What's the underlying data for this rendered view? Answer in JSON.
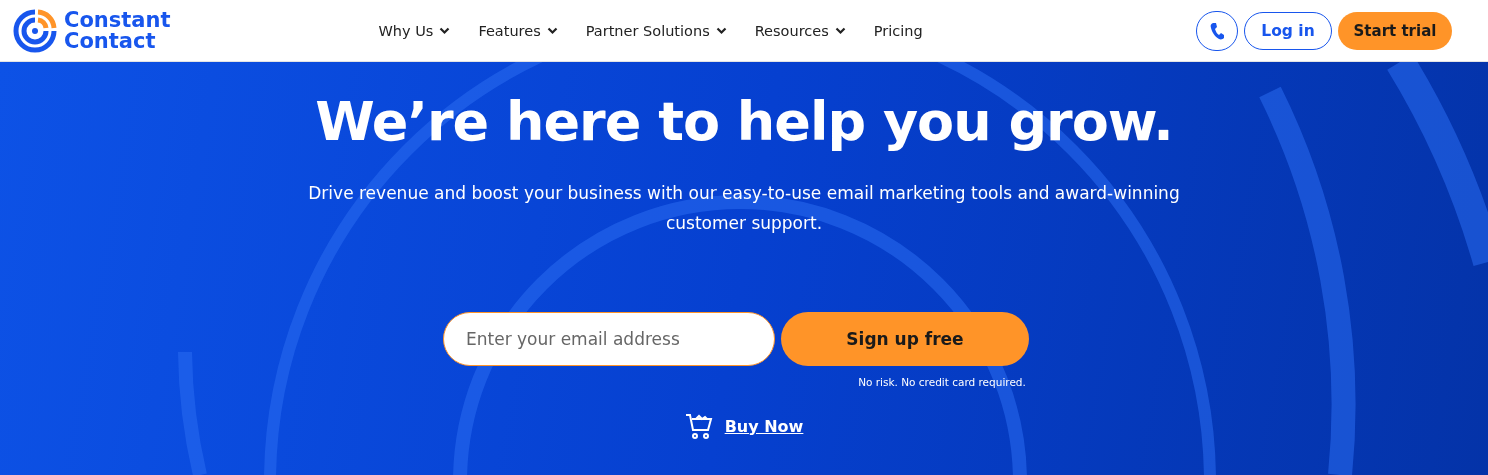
{
  "header": {
    "logo": {
      "line_1": "Constant",
      "line_2": "Contact"
    },
    "nav": [
      {
        "label": "Why Us",
        "has_menu": true
      },
      {
        "label": "Features",
        "has_menu": true
      },
      {
        "label": "Partner Solutions",
        "has_menu": true
      },
      {
        "label": "Resources",
        "has_menu": true
      },
      {
        "label": "Pricing",
        "has_menu": false
      }
    ],
    "login": "Log in",
    "start_trial": "Start trial"
  },
  "hero": {
    "title": "We’re here to help you grow.",
    "subtitle": "Drive revenue and boost your business with our easy-to-use email marketing tools and award-winning customer support.",
    "email_field": {
      "placeholder": "Enter your email address"
    },
    "signup": "Sign up free",
    "note": "No risk. No credit card required.",
    "buy_now": "Buy Now"
  }
}
